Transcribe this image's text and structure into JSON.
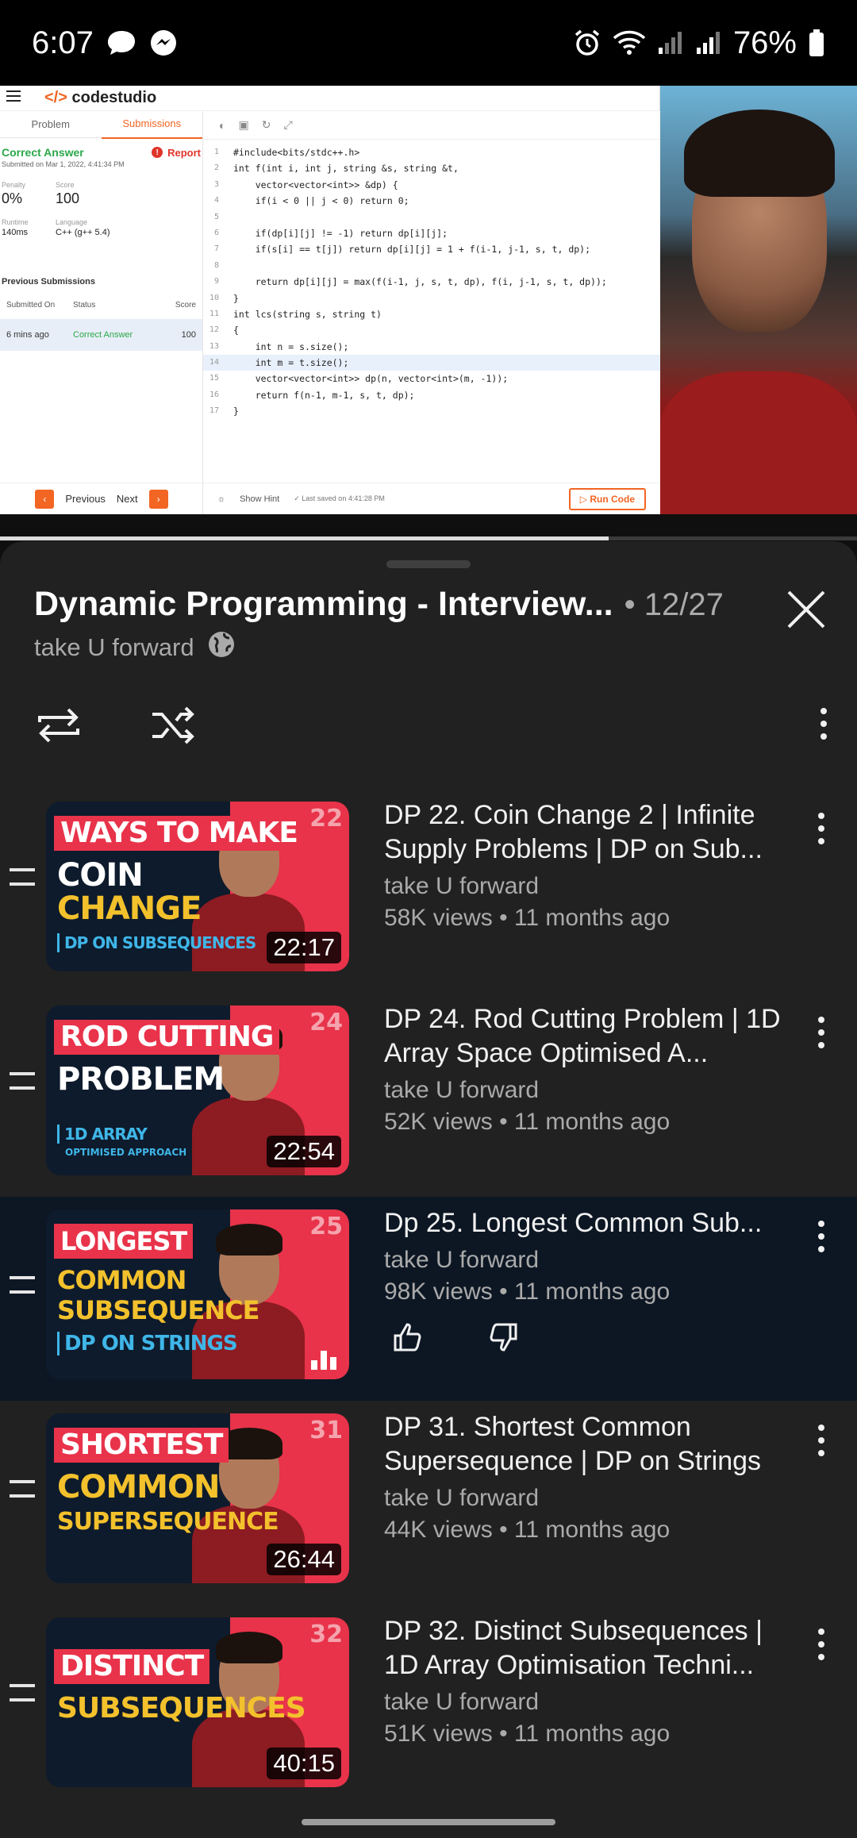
{
  "status_bar": {
    "time": "6:07",
    "battery": "76%",
    "left_icons": [
      "chat-bubble-icon",
      "messenger-icon"
    ],
    "right_icons": [
      "alarm-icon",
      "wifi-icon",
      "signal-icon",
      "signal-icon",
      "battery-icon"
    ]
  },
  "video": {
    "app_brand": "codestudio",
    "tabs": [
      "Problem",
      "Submissions"
    ],
    "result": "Correct Answer",
    "report_label": "Report",
    "submitted_on": "Submitted on Mar 1, 2022, 4:41:34 PM",
    "metrics": [
      {
        "label": "Penalty",
        "value": "0%"
      },
      {
        "label": "Score",
        "value": "100"
      },
      {
        "label": "Runtime",
        "value": "140ms"
      },
      {
        "label": "Language",
        "value": "C++ (g++ 5.4)"
      }
    ],
    "prev_title": "Previous Submissions",
    "prev_headers": [
      "Submitted On",
      "Status",
      "Score"
    ],
    "prev_row": [
      "6 mins ago",
      "Correct Answer",
      "100"
    ],
    "footer_prev": "Previous",
    "footer_next": "Next",
    "show_hint": "Show Hint",
    "last_saved": "Last saved on 4:41:28 PM",
    "run_code": "Run Code",
    "code_lines": [
      "#include<bits/stdc++.h>",
      "int f(int i, int j, string &s, string &t,",
      "    vector<vector<int>> &dp) {",
      "    if(i < 0 || j < 0) return 0;",
      "",
      "    if(dp[i][j] != -1) return dp[i][j];",
      "    if(s[i] == t[j]) return dp[i][j] = 1 + f(i-1, j-1, s, t, dp);",
      "",
      "    return dp[i][j] = max(f(i-1, j, s, t, dp), f(i, j-1, s, t, dp));",
      "}",
      "int lcs(string s, string t)",
      "{",
      "    int n = s.size();",
      "    int m = t.size();",
      "    vector<vector<int>> dp(n, vector<int>(m, -1));",
      "    return f(n-1, m-1, s, t, dp);",
      "}"
    ],
    "line_numbers": [
      "1",
      "2",
      "3",
      "4",
      "5",
      "6",
      "7",
      "8",
      "9",
      "10",
      "11",
      "12",
      "13",
      "14",
      "15",
      "16",
      "17"
    ],
    "progress_fraction": 0.71
  },
  "playlist": {
    "title": "Dynamic Programming - Interview...",
    "position": "• 12/27",
    "channel": "take U forward",
    "items": [
      {
        "title": "DP 22. Coin Change 2 | Infinite Supply Problems  | DP on Sub...",
        "channel": "take U forward",
        "meta": "58K views • 11 months ago",
        "duration": "22:17",
        "thumb": {
          "num": "22",
          "l1": "WAYS TO MAKE",
          "l2": "COIN",
          "l3": "CHANGE",
          "l4": "DP ON SUBSEQUENCES",
          "l5": ""
        }
      },
      {
        "title": "DP 24. Rod Cutting Problem | 1D Array Space Optimised A...",
        "channel": "take U forward",
        "meta": "52K views • 11 months ago",
        "duration": "22:54",
        "thumb": {
          "num": "24",
          "l1": "ROD CUTTING",
          "l2": "PROBLEM",
          "l3": "",
          "l4": "1D ARRAY",
          "l5": "OPTIMISED APPROACH"
        }
      },
      {
        "title": "Dp 25. Longest Common Sub...",
        "channel": "take U forward",
        "meta": "98K views • 11 months ago",
        "duration": "",
        "thumb": {
          "num": "25",
          "l1": "LONGEST",
          "l2": "COMMON",
          "l3": "SUBSEQUENCE",
          "l4": "DP ON STRINGS",
          "l5": ""
        }
      },
      {
        "title": "DP 31. Shortest Common Supersequence | DP on Strings",
        "channel": "take U forward",
        "meta": "44K views • 11 months ago",
        "duration": "26:44",
        "thumb": {
          "num": "31",
          "l1": "SHORTEST",
          "l2": "COMMON",
          "l3": "SUPERSEQUENCE",
          "l4": "",
          "l5": ""
        }
      },
      {
        "title": "DP 32. Distinct Subsequences | 1D Array Optimisation Techni...",
        "channel": "take U forward",
        "meta": "51K views • 11 months ago",
        "duration": "40:15",
        "thumb": {
          "num": "32",
          "l1": "DISTINCT",
          "l2": "SUBSEQUENCES",
          "l3": "",
          "l4": "",
          "l5": ""
        }
      }
    ]
  },
  "colors": {
    "sheet_bg": "#212121",
    "active_row_bg": "#0d1724",
    "accent_red": "#e8334a",
    "accent_yellow": "#f3c12c",
    "codestudio_orange": "#f26522"
  }
}
